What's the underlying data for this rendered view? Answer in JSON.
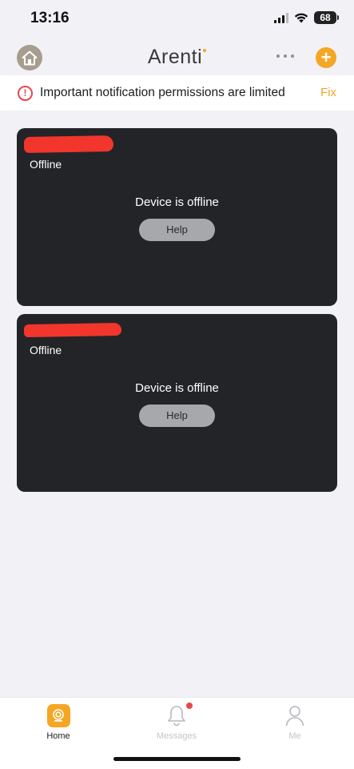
{
  "status_bar": {
    "time": "13:16",
    "battery": "68",
    "signal_icon": "cellular-signal-icon",
    "wifi_icon": "wifi-icon"
  },
  "header": {
    "brand": "Arenti",
    "home_icon": "house-icon",
    "more_icon": "more-dots-icon",
    "add_label": "+"
  },
  "notice": {
    "icon": "alert-circle-icon",
    "icon_glyph": "!",
    "text": "Important notification permissions are limited",
    "fix_label": "Fix"
  },
  "devices": [
    {
      "name": "[redacted]",
      "status": "Offline",
      "message": "Device is offline",
      "help_label": "Help"
    },
    {
      "name": "[redacted]",
      "status": "Offline",
      "message": "Device is offline",
      "help_label": "Help"
    }
  ],
  "tabs": [
    {
      "label": "Home",
      "icon": "camera-icon",
      "active": true
    },
    {
      "label": "Messages",
      "icon": "bell-icon",
      "has_badge": true
    },
    {
      "label": "Me",
      "icon": "person-icon"
    }
  ],
  "colors": {
    "accent": "#f5a623",
    "alert": "#e5484d",
    "card_bg": "#222428",
    "page_bg": "#f1f1f6"
  }
}
